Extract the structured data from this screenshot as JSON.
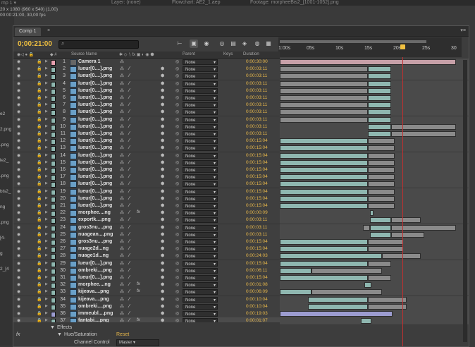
{
  "top_bar": {
    "title": "mp 1 ▾",
    "layer_tab": "Layer: (none)",
    "flowchart_tab": "Flowchart: AE2_1.aep",
    "footage_tab": "Footage: morpheeBis2_[1001-1052].png"
  },
  "project_info": {
    "dims": "20 x 1080  (960 x 540) (1,00)",
    "dur": "00:00:21:00, 30,00 fps"
  },
  "project_list": [
    "e2",
    "2.png",
    ".png",
    "le2_",
    ".png",
    "bis2_",
    "ng",
    ".png",
    "[4-",
    "g",
    "2_[4"
  ],
  "panel": {
    "tab_label": "Comp 1",
    "timecode": "0;00:21:00",
    "search_placeholder": ""
  },
  "columns": {
    "source": "Source Name",
    "parent": "Parent",
    "keys": "Keys",
    "duration": "Duration"
  },
  "ruler": {
    "ticks": [
      "1:00s",
      "05s",
      "10s",
      "15s",
      "20s",
      "25s",
      "30"
    ]
  },
  "colors": {
    "camera_label": "#e8a0b0",
    "comp_bar": "#c7a0a8",
    "layer_bar": "#8fb7b0",
    "violet_bar": "#9c9cd0",
    "duration_text": "#e8b84a",
    "cti": "#c03030"
  },
  "layers": [
    {
      "num": "1",
      "name": "Camera 1",
      "parent": "None",
      "duration": "0:00:30:00",
      "label": "#e8a0b0",
      "type": "camera",
      "bars": [
        [
          0,
          100,
          "#c7a0a8"
        ]
      ]
    },
    {
      "num": "2",
      "name": "lueur[0....].png",
      "parent": "None",
      "duration": "0:00:03:11",
      "label": "#8fb7b0",
      "bars": [
        [
          0,
          50,
          "#8a8a8a"
        ],
        [
          50,
          63,
          "#8fb7b0"
        ]
      ]
    },
    {
      "num": "3",
      "name": "lueur[0....].png",
      "parent": "None",
      "duration": "0:00:03:11",
      "label": "#8fb7b0",
      "bars": [
        [
          0,
          50,
          "#8a8a8a"
        ],
        [
          50,
          63,
          "#8fb7b0"
        ]
      ]
    },
    {
      "num": "4",
      "name": "lueur[0....].png",
      "parent": "None",
      "duration": "0:00:03:11",
      "label": "#8fb7b0",
      "bars": [
        [
          0,
          50,
          "#8a8a8a"
        ],
        [
          50,
          63,
          "#8fb7b0"
        ]
      ]
    },
    {
      "num": "5",
      "name": "lueur[0....].png",
      "parent": "None",
      "duration": "0:00:03:11",
      "label": "#8fb7b0",
      "bars": [
        [
          0,
          50,
          "#8a8a8a"
        ],
        [
          50,
          63,
          "#8fb7b0"
        ]
      ]
    },
    {
      "num": "6",
      "name": "lueur[0....].png",
      "parent": "None",
      "duration": "0:00:03:11",
      "label": "#8fb7b0",
      "bars": [
        [
          0,
          50,
          "#8a8a8a"
        ],
        [
          50,
          63,
          "#8fb7b0"
        ]
      ]
    },
    {
      "num": "7",
      "name": "lueur[0....].png",
      "parent": "None",
      "duration": "0:00:03:11",
      "label": "#8fb7b0",
      "bars": [
        [
          0,
          50,
          "#8a8a8a"
        ],
        [
          50,
          63,
          "#8fb7b0"
        ]
      ]
    },
    {
      "num": "8",
      "name": "lueur[0....].png",
      "parent": "None",
      "duration": "0:00:03:11",
      "label": "#8fb7b0",
      "bars": [
        [
          0,
          50,
          "#8a8a8a"
        ],
        [
          50,
          63,
          "#8fb7b0"
        ]
      ]
    },
    {
      "num": "9",
      "name": "lueur[0....].png",
      "parent": "None",
      "duration": "0:00:03:11",
      "label": "#8fb7b0",
      "bars": [
        [
          0,
          50,
          "#8a8a8a"
        ],
        [
          50,
          63,
          "#8fb7b0"
        ]
      ]
    },
    {
      "num": "10",
      "name": "lueur[0....].png",
      "parent": "None",
      "duration": "0:00:03:11",
      "label": "#8fb7b0",
      "bars": [
        [
          50,
          63,
          "#8fb7b0"
        ],
        [
          63,
          100,
          "#8a8a8a"
        ]
      ]
    },
    {
      "num": "11",
      "name": "lueur[0....].png",
      "parent": "None",
      "duration": "0:00:03:11",
      "label": "#8fb7b0",
      "bars": [
        [
          50,
          63,
          "#8fb7b0"
        ],
        [
          63,
          100,
          "#8a8a8a"
        ]
      ]
    },
    {
      "num": "12",
      "name": "lueur[0....].png",
      "parent": "None",
      "duration": "0:00:15:04",
      "label": "#8fb7b0",
      "bars": [
        [
          0,
          50,
          "#8fb7b0"
        ],
        [
          50,
          65,
          "#8a8a8a"
        ]
      ]
    },
    {
      "num": "13",
      "name": "lueur[0....].png",
      "parent": "None",
      "duration": "0:00:15:04",
      "label": "#8fb7b0",
      "bars": [
        [
          0,
          50,
          "#8fb7b0"
        ],
        [
          50,
          65,
          "#8a8a8a"
        ]
      ]
    },
    {
      "num": "14",
      "name": "lueur[0....].png",
      "parent": "None",
      "duration": "0:00:15:04",
      "label": "#8fb7b0",
      "bars": [
        [
          0,
          50,
          "#8fb7b0"
        ],
        [
          50,
          65,
          "#8a8a8a"
        ]
      ]
    },
    {
      "num": "15",
      "name": "lueur[0....].png",
      "parent": "None",
      "duration": "0:00:15:04",
      "label": "#8fb7b0",
      "bars": [
        [
          0,
          50,
          "#8fb7b0"
        ],
        [
          50,
          65,
          "#8a8a8a"
        ]
      ]
    },
    {
      "num": "16",
      "name": "lueur[0....].png",
      "parent": "None",
      "duration": "0:00:15:04",
      "label": "#8fb7b0",
      "bars": [
        [
          0,
          50,
          "#8fb7b0"
        ],
        [
          50,
          65,
          "#8a8a8a"
        ]
      ]
    },
    {
      "num": "17",
      "name": "lueur[0....].png",
      "parent": "None",
      "duration": "0:00:15:04",
      "label": "#8fb7b0",
      "bars": [
        [
          0,
          50,
          "#8fb7b0"
        ],
        [
          50,
          65,
          "#8a8a8a"
        ]
      ]
    },
    {
      "num": "18",
      "name": "lueur[0....].png",
      "parent": "None",
      "duration": "0:00:15:04",
      "label": "#8fb7b0",
      "bars": [
        [
          0,
          50,
          "#8fb7b0"
        ],
        [
          50,
          65,
          "#8a8a8a"
        ]
      ]
    },
    {
      "num": "19",
      "name": "lueur[0....].png",
      "parent": "None",
      "duration": "0:00:15:04",
      "label": "#8fb7b0",
      "bars": [
        [
          0,
          50,
          "#8fb7b0"
        ],
        [
          50,
          65,
          "#8a8a8a"
        ]
      ]
    },
    {
      "num": "20",
      "name": "lueur[0....].png",
      "parent": "None",
      "duration": "0:00:15:04",
      "label": "#8fb7b0",
      "bars": [
        [
          0,
          50,
          "#8fb7b0"
        ],
        [
          50,
          65,
          "#8a8a8a"
        ]
      ]
    },
    {
      "num": "21",
      "name": "lueur[0....].png",
      "parent": "None",
      "duration": "0:00:15:04",
      "label": "#8fb7b0",
      "bars": [
        [
          0,
          50,
          "#8fb7b0"
        ],
        [
          50,
          65,
          "#8a8a8a"
        ]
      ]
    },
    {
      "num": "22",
      "name": "morphee....ng",
      "parent": "None",
      "duration": "0:00:00:09",
      "label": "#8fb7b0",
      "fx": true,
      "bars": [
        [
          51,
          53,
          "#8fb7b0"
        ]
      ]
    },
    {
      "num": "23",
      "name": "exportk....png",
      "parent": "None",
      "duration": "0:00:03:11",
      "label": "#8fb7b0",
      "bars": [
        [
          51,
          63,
          "#8fb7b0"
        ],
        [
          63,
          80,
          "#8a8a8a"
        ]
      ]
    },
    {
      "num": "24",
      "name": "gros3nu....png",
      "parent": "None",
      "duration": "0:00:03:11",
      "label": "#8fb7b0",
      "bars": [
        [
          47,
          51,
          "#8a8a8a"
        ],
        [
          51,
          63,
          "#8fb7b0"
        ],
        [
          63,
          100,
          "#8a8a8a"
        ]
      ]
    },
    {
      "num": "25",
      "name": "nuagean....png",
      "parent": "None",
      "duration": "0:00:03:11",
      "label": "#8fb7b0",
      "bars": [
        [
          51,
          63,
          "#8fb7b0"
        ],
        [
          63,
          82,
          "#8a8a8a"
        ]
      ]
    },
    {
      "num": "26",
      "name": "gros3nu....png",
      "parent": "None",
      "duration": "0:00:15:04",
      "label": "#8fb7b0",
      "bars": [
        [
          0,
          50,
          "#8fb7b0"
        ],
        [
          50,
          70,
          "#8a8a8a"
        ]
      ]
    },
    {
      "num": "27",
      "name": "nuage2d...ng",
      "parent": "None",
      "duration": "0:00:15:04",
      "label": "#8fb7b0",
      "bars": [
        [
          0,
          50,
          "#8fb7b0"
        ],
        [
          50,
          70,
          "#8a8a8a"
        ]
      ]
    },
    {
      "num": "28",
      "name": "nuage1d...ng",
      "parent": "None",
      "duration": "0:00:24:03",
      "label": "#8fb7b0",
      "bars": [
        [
          0,
          58,
          "#8fb7b0"
        ],
        [
          58,
          80,
          "#8a8a8a"
        ]
      ]
    },
    {
      "num": "29",
      "name": "lueur[0....].png",
      "parent": "None",
      "duration": "0:00:15:04",
      "label": "#8fb7b0",
      "bars": [
        [
          0,
          50,
          "#8fb7b0"
        ],
        [
          50,
          63,
          "#8a8a8a"
        ]
      ]
    },
    {
      "num": "30",
      "name": "ombreki....png",
      "parent": "None",
      "duration": "0:00:06:11",
      "label": "#8fb7b0",
      "bars": [
        [
          0,
          18,
          "#8fb7b0"
        ],
        [
          18,
          58,
          "#8a8a8a"
        ]
      ]
    },
    {
      "num": "31",
      "name": "lueur[0....].png",
      "parent": "None",
      "duration": "0:00:15:04",
      "label": "#8fb7b0",
      "bars": [
        [
          0,
          50,
          "#8fb7b0"
        ],
        [
          50,
          63,
          "#8a8a8a"
        ]
      ]
    },
    {
      "num": "32",
      "name": "morphee....ng",
      "parent": "None",
      "duration": "0:00:01:08",
      "label": "#8fb7b0",
      "fx": true,
      "bars": [
        [
          48,
          52,
          "#8fb7b0"
        ]
      ]
    },
    {
      "num": "33",
      "name": "kijeava....png",
      "parent": "None",
      "duration": "0:00:06:09",
      "label": "#8fb7b0",
      "fx": true,
      "bars": [
        [
          0,
          18,
          "#8fb7b0"
        ],
        [
          18,
          58,
          "#8a8a8a"
        ]
      ]
    },
    {
      "num": "34",
      "name": "kijeava....png",
      "parent": "None",
      "duration": "0:00:10:04",
      "label": "#8fb7b0",
      "bars": [
        [
          16,
          50,
          "#8fb7b0"
        ],
        [
          50,
          72,
          "#8a8a8a"
        ]
      ]
    },
    {
      "num": "35",
      "name": "ombreki....png",
      "parent": "None",
      "duration": "0:00:10:04",
      "label": "#8fb7b0",
      "bars": [
        [
          16,
          50,
          "#8fb7b0"
        ],
        [
          50,
          72,
          "#8a8a8a"
        ]
      ]
    },
    {
      "num": "36",
      "name": "immeubl....png",
      "parent": "None",
      "duration": "0:00:19:03",
      "label": "#9c9cd0",
      "bars": [
        [
          0,
          64,
          "#9c9cd0"
        ]
      ]
    },
    {
      "num": "37",
      "name": "fantabi....png",
      "parent": "None",
      "duration": "0:00:01:07",
      "label": "#8fb7b0",
      "fx": true,
      "sel": true,
      "bars": [
        [
          46,
          52,
          "#8fb7b0"
        ]
      ]
    }
  ],
  "effects": {
    "heading": "Effects",
    "effect_name": "Hue/Saturation",
    "reset": "Reset",
    "fx_icon": "fx",
    "channel_label": "Channel Control",
    "channel_value": "Master"
  }
}
